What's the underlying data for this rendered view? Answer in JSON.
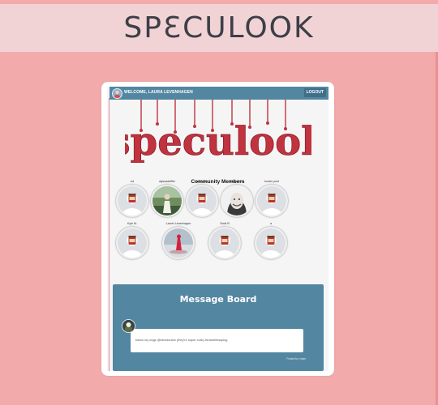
{
  "banner": {
    "title": "SPƐCULOOK"
  },
  "nav": {
    "welcome": "WELCOME, LAURA LEVENHAGEN",
    "logout": "LOGOUT"
  },
  "logo": {
    "text": "speculook",
    "color": "#c0333f"
  },
  "community": {
    "title": "Community Members",
    "members": [
      {
        "name": "ed",
        "avatar": "cookie-jar-placeholder"
      },
      {
        "name": "alyssaddiffer",
        "avatar": "photo-person-outdoors"
      },
      {
        "name": "samuelrn",
        "avatar": "cookie-jar-placeholder"
      },
      {
        "name": "Emily Kern",
        "avatar": "photo-smiling-woman"
      },
      {
        "name": "hunter post",
        "avatar": "cookie-jar-placeholder"
      },
      {
        "name": "Kyle M.",
        "avatar": "cookie-jar-placeholder"
      },
      {
        "name": "Laurel Levenhagen",
        "avatar": "photo-red-figure"
      },
      {
        "name": "Scott B",
        "avatar": "cookie-jar-placeholder"
      },
      {
        "name": "a",
        "avatar": "cookie-jar-placeholder"
      }
    ]
  },
  "message_board": {
    "title": "Message Board",
    "post": {
      "text": "follow my dogs @ebonidutch (they're super cute) #shamelessplug",
      "meta": "Posted by: nipes"
    }
  },
  "colors": {
    "page_bg": "#f2aaab",
    "banner_bg": "#f1d3d6",
    "nav_bg": "#5386a0",
    "board_bg": "#5386a0"
  }
}
